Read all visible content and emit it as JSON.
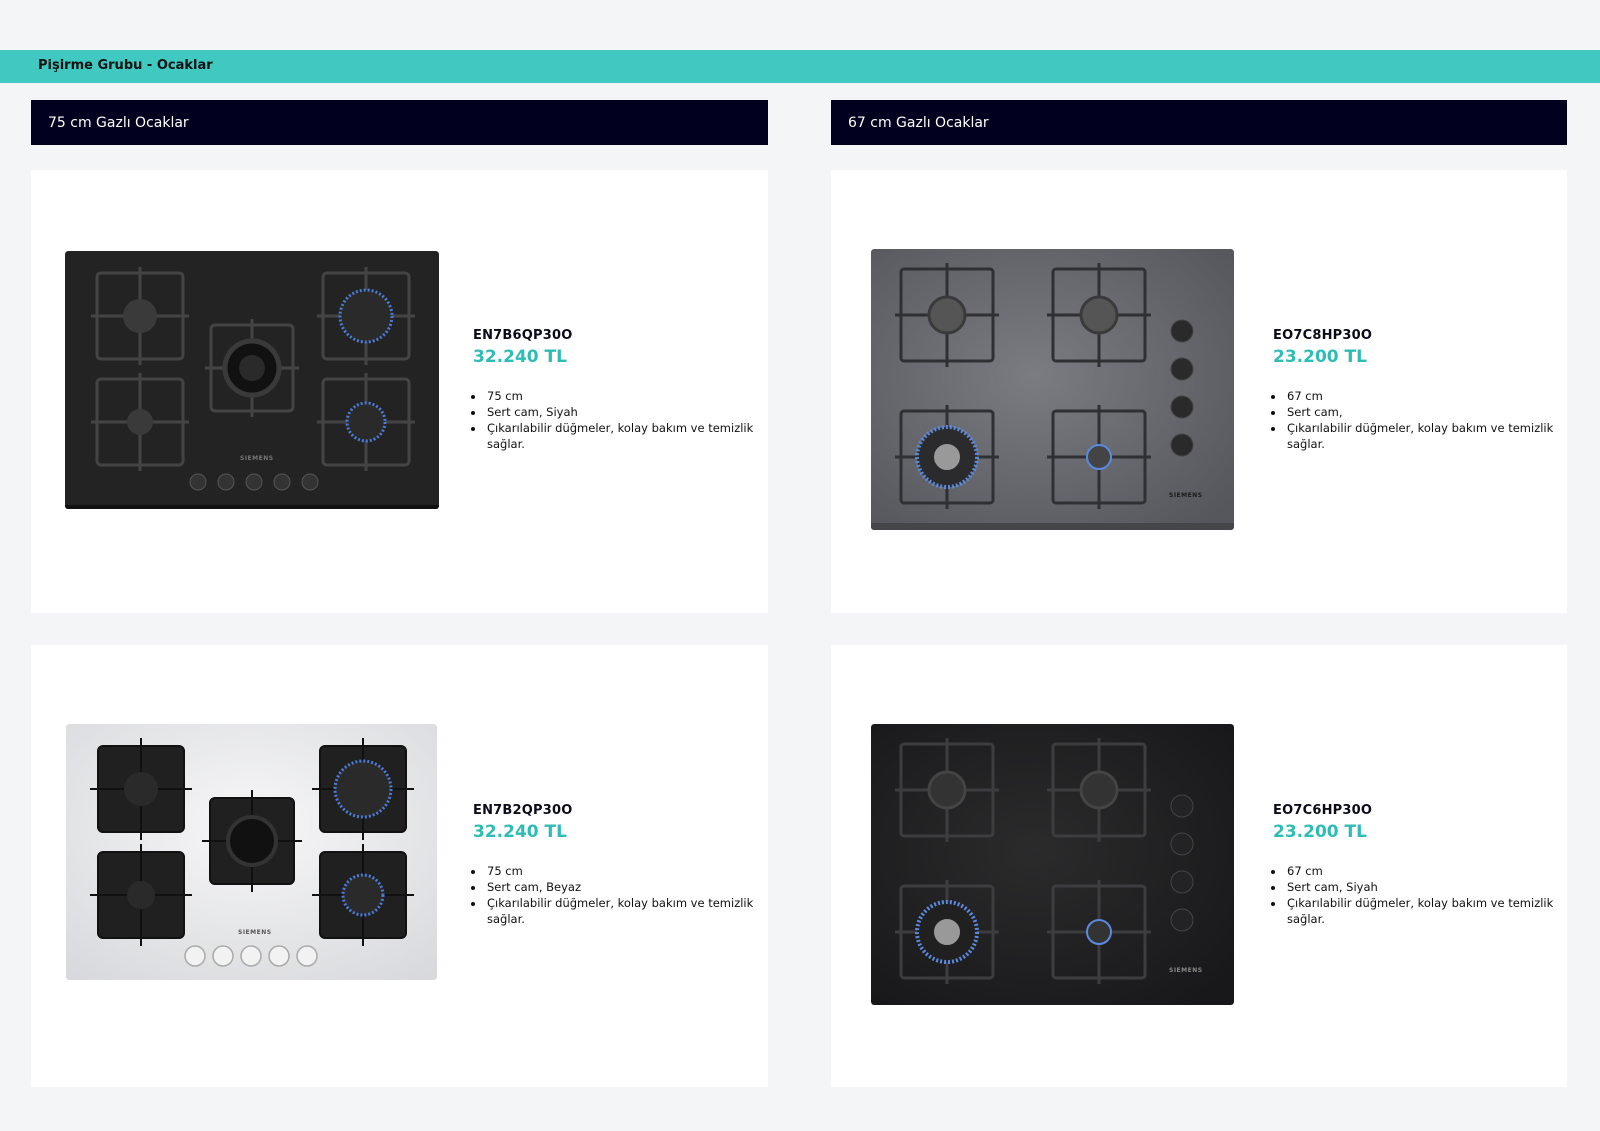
{
  "group_title": "Pişirme Grubu - Ocaklar",
  "columns": [
    {
      "title": "75 cm Gazlı Ocaklar"
    },
    {
      "title": "67 cm Gazlı Ocaklar"
    }
  ],
  "products": [
    {
      "model": "EN7B6QP30O",
      "price": "32.240 TL",
      "specs": [
        "75 cm",
        "Sert cam, Siyah",
        "Çıkarılabilir düğmeler, kolay bakım ve temizlik sağlar."
      ],
      "brand": "SIEMENS",
      "hob_color": "#232323"
    },
    {
      "model": "EO7C8HP30O",
      "price": "23.200 TL",
      "specs": [
        "67 cm",
        "Sert cam,",
        "Çıkarılabilir düğmeler, kolay bakım ve temizlik sağlar."
      ],
      "brand": "SIEMENS",
      "hob_color": "#5c5e63"
    },
    {
      "model": "EN7B2QP30O",
      "price": "32.240 TL",
      "specs": [
        "75 cm",
        "Sert cam, Beyaz",
        "Çıkarılabilir düğmeler, kolay bakım ve temizlik sağlar."
      ],
      "brand": "SIEMENS",
      "hob_color": "#e9eaec"
    },
    {
      "model": "EO7C6HP30O",
      "price": "23.200 TL",
      "specs": [
        "67 cm",
        "Sert cam, Siyah",
        "Çıkarılabilir düğmeler, kolay bakım ve temizlik sağlar."
      ],
      "brand": "SIEMENS",
      "hob_color": "#1d1d1e"
    }
  ],
  "colors": {
    "accent": "#40c9c0",
    "price": "#2dbdb4",
    "header": "#01011f"
  }
}
